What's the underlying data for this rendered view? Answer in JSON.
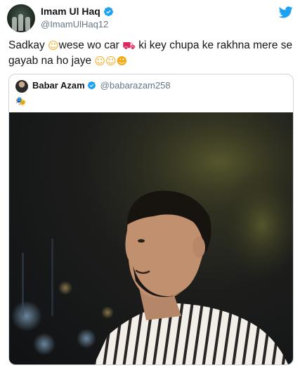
{
  "author": {
    "name": "Imam Ul Haq",
    "handle": "@ImamUlHaq12",
    "verified": true
  },
  "tweet": {
    "text_parts": [
      "Sadkay ",
      "wese wo car ",
      " ki key chupa ke rakhna mere se gayab na ho jaye "
    ],
    "emojis": [
      "smiling-face-with-hearts",
      "red-car",
      "face-with-monocle",
      "face-with-monocle",
      "face-with-tears-of-joy"
    ]
  },
  "quoted_tweet": {
    "name": "Babar Azam",
    "handle": "@babarazam258",
    "verified": true,
    "text_emoji": "performing-arts-masks",
    "media": "photo-man-striped-shirt-night-city"
  },
  "icons": {
    "platform": "twitter-bird-icon",
    "verified": "verified-badge-icon"
  },
  "colors": {
    "brand_blue": "#1da1f2",
    "text_primary": "#14171a",
    "text_secondary": "#657786",
    "border": "#ccd6dd"
  }
}
